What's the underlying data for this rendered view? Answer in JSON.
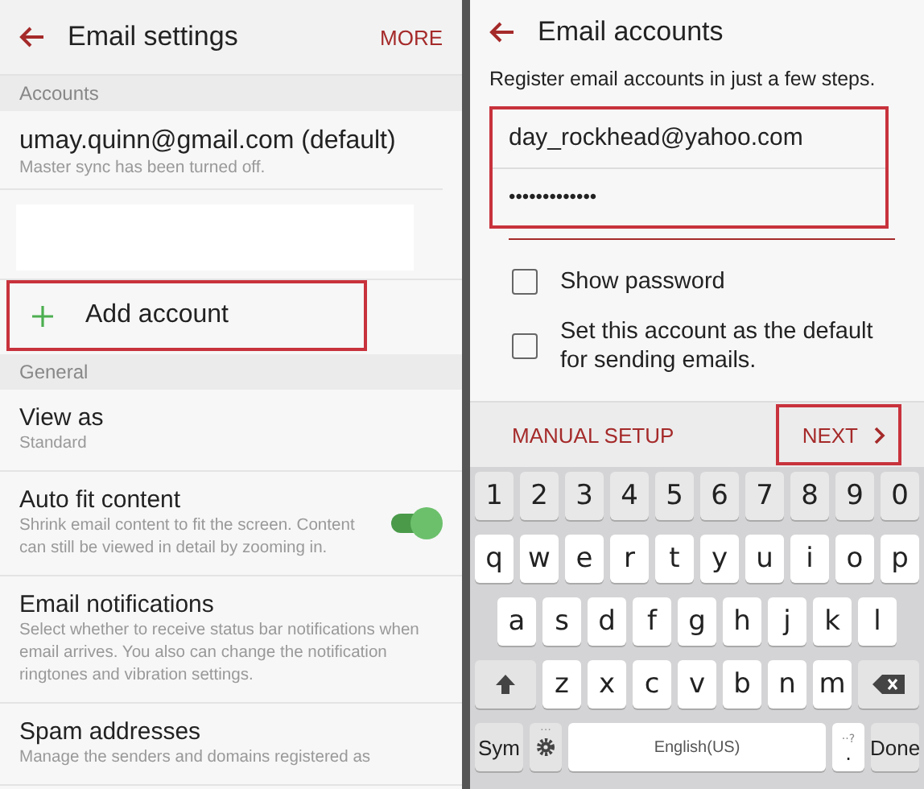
{
  "left": {
    "title": "Email settings",
    "action": "MORE",
    "sections": [
      {
        "header": "Accounts",
        "items": [
          {
            "kind": "account",
            "title": "umay.quinn@gmail.com (default)",
            "subtitle": "Master sync has been turned off."
          },
          {
            "kind": "blank"
          },
          {
            "kind": "add",
            "label": "Add account",
            "highlighted": true
          }
        ]
      },
      {
        "header": "General",
        "items": [
          {
            "kind": "setting",
            "title": "View as",
            "subtitle": "Standard"
          },
          {
            "kind": "toggle",
            "title": "Auto fit content",
            "subtitle": "Shrink email content to fit the screen. Content can still be viewed in detail by zooming in.",
            "on": true
          },
          {
            "kind": "setting",
            "title": "Email notifications",
            "subtitle": "Select whether to receive status bar notifications when email arrives. You also can change the notification ringtones and vibration settings."
          },
          {
            "kind": "setting",
            "title": "Spam addresses",
            "subtitle": "Manage the senders and domains registered as"
          }
        ]
      }
    ]
  },
  "right": {
    "title": "Email accounts",
    "intro": "Register email accounts in just a few steps.",
    "fields": [
      {
        "kind": "email",
        "value": "day_rockhead@yahoo.com"
      },
      {
        "kind": "password",
        "value": "•••••••••••••"
      }
    ],
    "fields_highlighted": true,
    "checkboxes": [
      {
        "label": "Show password",
        "checked": false
      },
      {
        "label": "Set this account as the default for sending emails.",
        "checked": false
      }
    ],
    "manual_setup": "MANUAL SETUP",
    "next": {
      "label": "NEXT",
      "highlighted": true
    },
    "keyboard": {
      "number_keys": [
        {
          "kind": "num",
          "label": "1"
        },
        {
          "kind": "num",
          "label": "2"
        },
        {
          "kind": "num",
          "label": "3"
        },
        {
          "kind": "num",
          "label": "4"
        },
        {
          "kind": "num",
          "label": "5"
        },
        {
          "kind": "num",
          "label": "6"
        },
        {
          "kind": "num",
          "label": "7"
        },
        {
          "kind": "num",
          "label": "8"
        },
        {
          "kind": "num",
          "label": "9"
        },
        {
          "kind": "num",
          "label": "0"
        }
      ],
      "top_letter_keys": [
        {
          "kind": "key",
          "label": "q"
        },
        {
          "kind": "key",
          "label": "w"
        },
        {
          "kind": "key",
          "label": "e"
        },
        {
          "kind": "key",
          "label": "r"
        },
        {
          "kind": "key",
          "label": "t"
        },
        {
          "kind": "key",
          "label": "y"
        },
        {
          "kind": "key",
          "label": "u"
        },
        {
          "kind": "key",
          "label": "i"
        },
        {
          "kind": "key",
          "label": "o"
        },
        {
          "kind": "key",
          "label": "p"
        }
      ],
      "middle_letter_keys": [
        {
          "kind": "key",
          "label": "a"
        },
        {
          "kind": "key",
          "label": "s"
        },
        {
          "kind": "key",
          "label": "d"
        },
        {
          "kind": "key",
          "label": "f"
        },
        {
          "kind": "key",
          "label": "g"
        },
        {
          "kind": "key",
          "label": "h"
        },
        {
          "kind": "key",
          "label": "j"
        },
        {
          "kind": "key",
          "label": "k"
        },
        {
          "kind": "key",
          "label": "l"
        }
      ],
      "bottom_letter_keys": [
        {
          "kind": "shift"
        },
        {
          "kind": "key",
          "label": "z"
        },
        {
          "kind": "key",
          "label": "x"
        },
        {
          "kind": "key",
          "label": "c"
        },
        {
          "kind": "key",
          "label": "v"
        },
        {
          "kind": "key",
          "label": "b"
        },
        {
          "kind": "key",
          "label": "n"
        },
        {
          "kind": "key",
          "label": "m"
        },
        {
          "kind": "backspace"
        }
      ],
      "function_keys": [
        {
          "kind": "func",
          "label": "Sym"
        },
        {
          "kind": "settings",
          "hint": "···"
        },
        {
          "kind": "space",
          "label": "English(US)"
        },
        {
          "kind": "period",
          "label": ".",
          "hint": "··?"
        },
        {
          "kind": "func",
          "label": "Done"
        }
      ]
    }
  }
}
